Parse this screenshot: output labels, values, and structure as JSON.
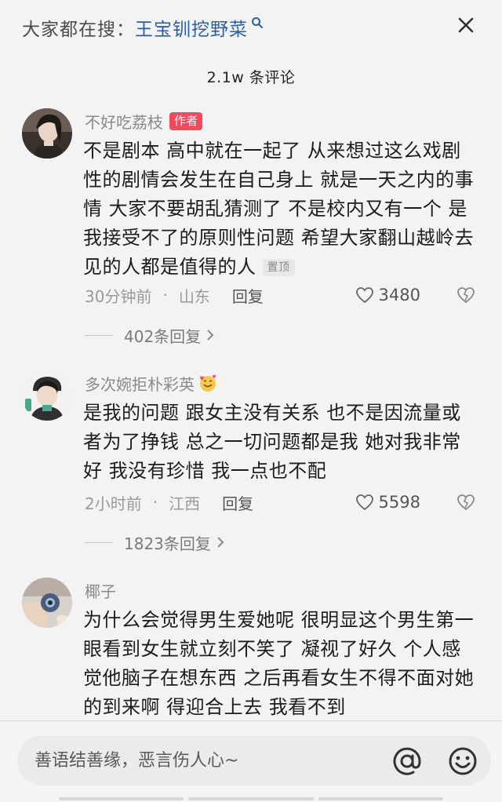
{
  "search": {
    "prefix": "大家都在搜：",
    "keyword": "王宝钏挖野菜"
  },
  "header": {
    "comment_count": "2.1w 条评论"
  },
  "comments": [
    {
      "username": "不好吃荔枝",
      "badge": "作者",
      "text": "不是剧本 高中就在一起了 从来想过这么戏剧性的剧情会发生在自己身上 就是一天之内的事情 大家不要胡乱猜测了 不是校内又有一个 是我接受不了的原则性问题 希望大家翻山越岭去见的人都是值得的人",
      "pinned_label": "置顶",
      "time": "30分钟前",
      "location": "山东",
      "reply_label": "回复",
      "likes": "3480",
      "replies": "402条回复"
    },
    {
      "username": "多次婉拒朴彩英",
      "text": "是我的问题 跟女主没有关系 也不是因流量或者为了挣钱 总之一切问题都是我 她对我非常好 我没有珍惜 我一点也不配",
      "time": "2小时前",
      "location": "江西",
      "reply_label": "回复",
      "likes": "5598",
      "replies": "1823条回复"
    },
    {
      "username": "椰子",
      "text": "为什么会觉得男生爱她呢 很明显这个男生第一眼看到女生就立刻不笑了 凝视了好久 个人感觉他脑子在想东西 之后再看女生不得不面对她的到来啊 得迎合上去 我看不到"
    }
  ],
  "input": {
    "placeholder": "善语结善缘，恶言伤人心~"
  },
  "colors": {
    "keyword": "#2b5fa8",
    "author_badge": "#f04a5b"
  }
}
